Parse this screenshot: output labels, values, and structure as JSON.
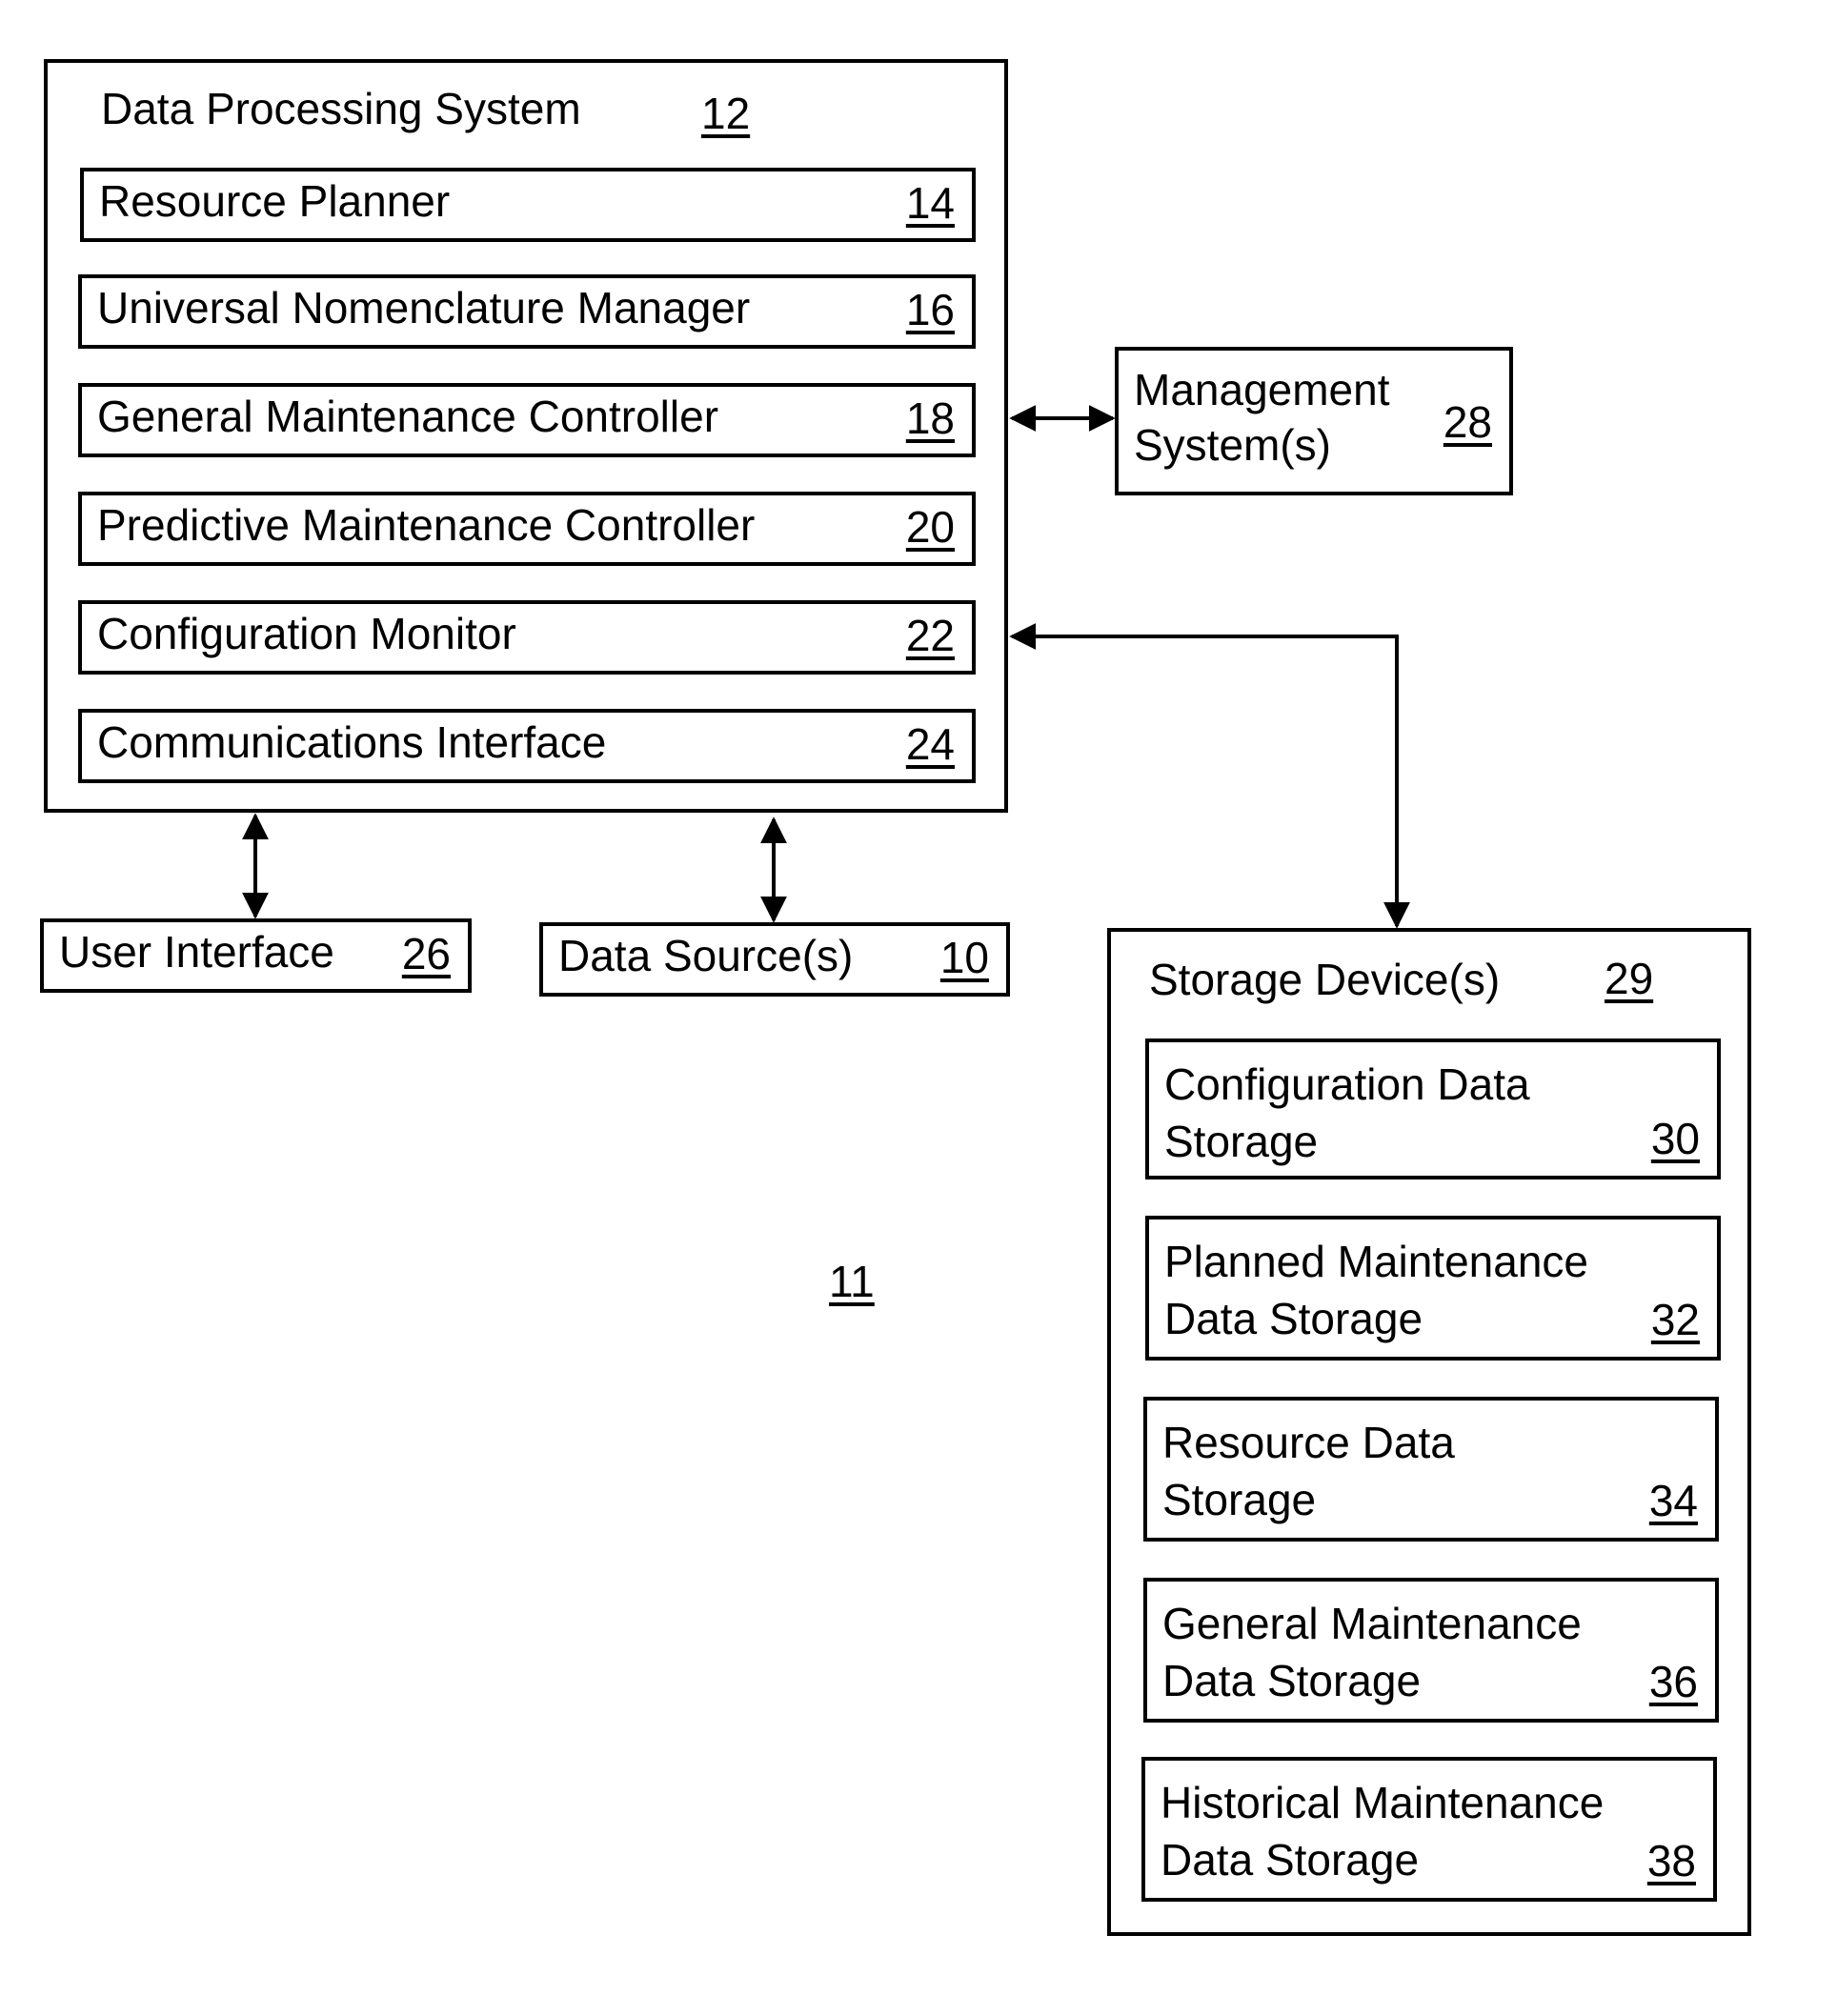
{
  "figure_ref": "11",
  "data_processing_system": {
    "title": "Data Processing System",
    "ref": "12",
    "components": [
      {
        "label": "Resource Planner",
        "ref": "14"
      },
      {
        "label": "Universal Nomenclature Manager",
        "ref": "16"
      },
      {
        "label": "General Maintenance Controller",
        "ref": "18"
      },
      {
        "label": "Predictive Maintenance Controller",
        "ref": "20"
      },
      {
        "label": "Configuration Monitor",
        "ref": "22"
      },
      {
        "label": "Communications Interface",
        "ref": "24"
      }
    ]
  },
  "management_systems": {
    "label": "Management\nSystem(s)",
    "ref": "28"
  },
  "user_interface": {
    "label": "User Interface",
    "ref": "26"
  },
  "data_sources": {
    "label": "Data Source(s)",
    "ref": "10"
  },
  "storage_devices": {
    "title": "Storage Device(s)",
    "ref": "29",
    "components": [
      {
        "label": "Configuration Data\nStorage",
        "ref": "30"
      },
      {
        "label": "Planned Maintenance\nData Storage",
        "ref": "32"
      },
      {
        "label": "Resource Data\nStorage",
        "ref": "34"
      },
      {
        "label": "General Maintenance\nData Storage",
        "ref": "36"
      },
      {
        "label": "Historical Maintenance\nData Storage",
        "ref": "38"
      }
    ]
  },
  "connections": [
    {
      "from": "data-processing-system",
      "to": "management-systems",
      "type": "bidirectional"
    },
    {
      "from": "data-processing-system",
      "to": "storage-devices",
      "type": "bidirectional"
    },
    {
      "from": "data-processing-system",
      "to": "user-interface",
      "type": "bidirectional"
    },
    {
      "from": "data-processing-system",
      "to": "data-sources",
      "type": "bidirectional"
    }
  ]
}
